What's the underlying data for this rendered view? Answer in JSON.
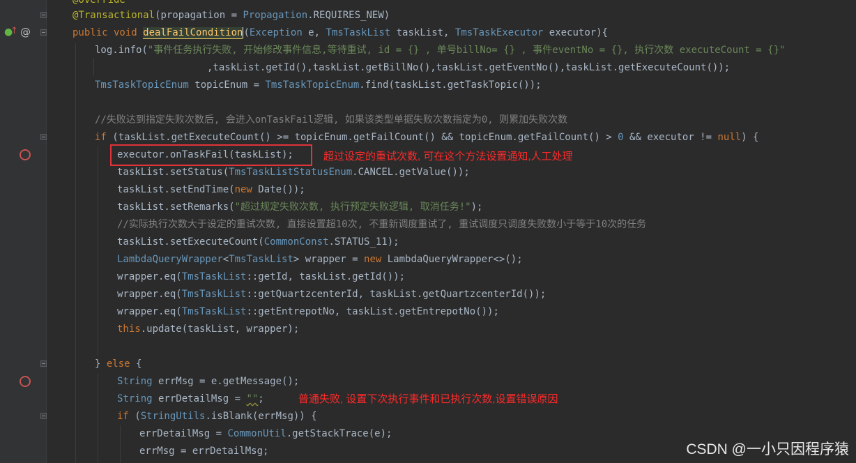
{
  "code": {
    "l0": "@Override",
    "l1_ann": "@Transactional",
    "l1_a": "(propagation = ",
    "l1_cls": "Propagation",
    "l1_b": ".REQUIRES_NEW)",
    "l2_kw": "public void ",
    "l2_fn": "dealFailCondition",
    "l2_a": "(",
    "l2_t1": "Exception",
    "l2_b": " e, ",
    "l2_t2": "TmsTaskList",
    "l2_c": " taskList, ",
    "l2_t3": "TmsTaskExecutor",
    "l2_d": " executor){",
    "l3_a": "log.info(",
    "l3_str": "\"事件任务执行失败, 开始修改事件信息,等待重试, id = {} , 单号billNo= {} , 事件eventNo = {}, 执行次数 executeCount = {}\"",
    "l4": ",taskList.getId(),taskList.getBillNo(),taskList.getEventNo(),taskList.getExecuteCount());",
    "l5_t": "TmsTaskTopicEnum",
    "l5_a": " topicEnum = ",
    "l5_t2": "TmsTaskTopicEnum",
    "l5_b": ".find(taskList.getTaskTopic());",
    "l7_cmt": "//失败达到指定失败次数后, 会进入onTaskFail逻辑, 如果该类型单据失败次数指定为0, 则累加失败次数",
    "l8_kw": "if",
    "l8_a": " (taskList.getExecuteCount() >= topicEnum.getFailCount() && topicEnum.getFailCount() > ",
    "l8_num": "0",
    "l8_b": " && executor != ",
    "l8_null": "null",
    "l8_c": ") {",
    "l9": "executor.onTaskFail(taskList);",
    "l10_a": "taskList.setStatus(",
    "l10_t": "TmsTaskListStatusEnum",
    "l10_b": ".CANCEL.getValue());",
    "l11_a": "taskList.setEndTime(",
    "l11_kw": "new",
    "l11_b": " Date());",
    "l12_a": "taskList.setRemarks(",
    "l12_str": "\"超过规定失败次数, 执行预定失败逻辑, 取消任务!\"",
    "l12_b": ");",
    "l13_cmt": "//实际执行次数大于设定的重试次数, 直接设置超10次, 不重新调度重试了, 重试调度只调度失败数小于等于10次的任务",
    "l14_a": "taskList.setExecuteCount(",
    "l14_t": "CommonConst",
    "l14_b": ".STATUS_11);",
    "l15_t": "LambdaQueryWrapper",
    "l15_a": "<",
    "l15_t2": "TmsTaskList",
    "l15_b": "> wrapper = ",
    "l15_kw": "new",
    "l15_c": " LambdaQueryWrapper<>();",
    "l16_a": "wrapper.eq(",
    "l16_t": "TmsTaskList",
    "l16_b": "::getId, taskList.getId());",
    "l17_a": "wrapper.eq(",
    "l17_t": "TmsTaskList",
    "l17_b": "::getQuartzcenterId, taskList.getQuartzcenterId());",
    "l18_a": "wrapper.eq(",
    "l18_t": "TmsTaskList",
    "l18_b": "::getEntrepotNo, taskList.getEntrepotNo());",
    "l19_kw": "this",
    "l19_a": ".update(taskList, wrapper);",
    "l21_a": "} ",
    "l21_kw": "else",
    "l21_b": " {",
    "l22_t": "String",
    "l22_a": " errMsg = e.getMessage();",
    "l23_t": "String",
    "l23_a": " errDetailMsg = ",
    "l23_str": "\"\"",
    "l23_b": ";",
    "l24_kw": "if",
    "l24_a": " (",
    "l24_t": "StringUtils",
    "l24_b": ".isBlank(errMsg)) {",
    "l25_a": "errDetailMsg = ",
    "l25_t": "CommonUtil",
    "l25_b": ".getStackTrace(e);",
    "l26": "errMsg = errDetailMsg;"
  },
  "annotations": {
    "note1": "超过设定的重试次数, 可在这个方法设置通知,人工处理",
    "note2": "普通失败, 设置下次执行事件和已执行次数,设置错误原因"
  },
  "gutter_icons": {
    "override": "override-up-arrow-icon",
    "at": "@"
  },
  "watermark": "CSDN @一小只因程序猿",
  "colors": {
    "background": "#2b2b2b",
    "keyword": "#cc7832",
    "string": "#6a8759",
    "type": "#6897bb",
    "comment": "#808080",
    "annotation_red": "#ff2a2a"
  }
}
